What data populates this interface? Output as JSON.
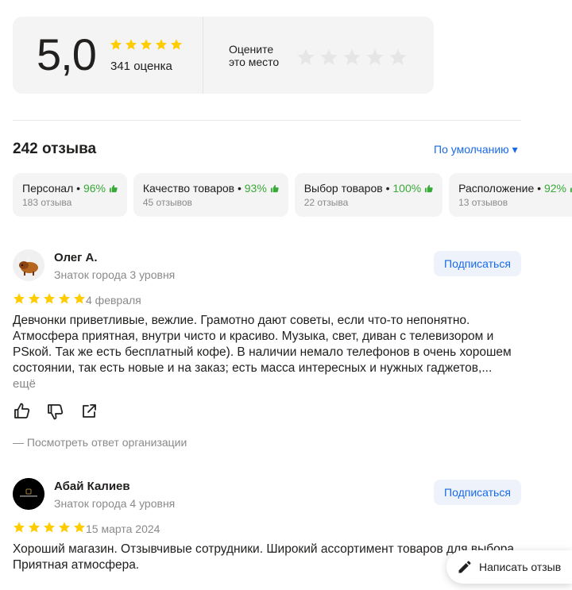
{
  "summary": {
    "score": "5,0",
    "rating": 5.0,
    "ratings_count": "341 оценка",
    "rate_prompt_line1": "Оцените",
    "rate_prompt_line2": "это место",
    "star_color": "#ffcc00",
    "empty_star_color": "#e6e6e6"
  },
  "reviews_header": {
    "title": "242 отзыва",
    "sort": "По умолчанию ▾"
  },
  "aspects": [
    {
      "name": "Персонал",
      "percent": "96%",
      "count": "183 отзыва"
    },
    {
      "name": "Качество товаров",
      "percent": "93%",
      "count": "45 отзывов"
    },
    {
      "name": "Выбор товаров",
      "percent": "100%",
      "count": "22 отзыва"
    },
    {
      "name": "Расположение",
      "percent": "92%",
      "count": "13 отзывов"
    }
  ],
  "reviews": [
    {
      "author": "Олег А.",
      "level": "Знаток города 3 уровня",
      "subscribe": "Подписаться",
      "rating": 5,
      "date": "4 февраля",
      "text": "Девчонки приветливые, вежлие. Грамотно дают советы, если что-то непонятно. Атмосфера приятная, внутри чисто и красиво. Музыка, свет, диван с телевизором и PSкой. Так же есть бесплатный кофе). В наличии немало телефонов в очень хорошем состоянии, так есть новые и на заказ; есть масса интересных и нужных гаджетов,...",
      "more": "ещё",
      "org_reply": "— Посмотреть ответ организации",
      "avatar_icon": "yak-icon"
    },
    {
      "author": "Абай Калиев",
      "level": "Знаток города 4 уровня",
      "subscribe": "Подписаться",
      "rating": 5,
      "date": "15 марта 2024",
      "text_lines": [
        "Хороший магазин. Отзывчивые сотрудники. Широкий ассортимент товаров для выбора.",
        "Приятная атмосфера."
      ],
      "avatar_icon": "black-logo-avatar"
    }
  ],
  "write_review": "Написать отзыв",
  "colors": {
    "accent": "#1a6ae8",
    "positive": "#39a938",
    "muted": "#8a8a8a"
  }
}
